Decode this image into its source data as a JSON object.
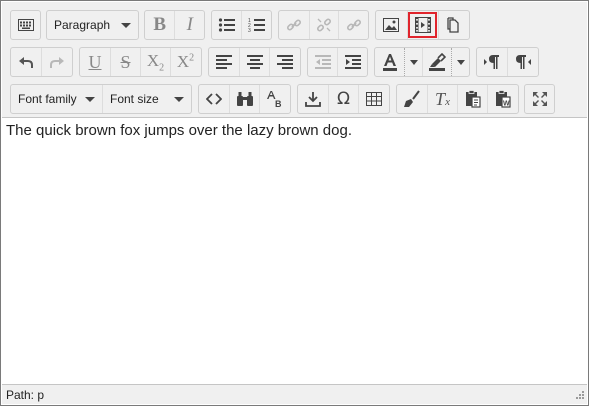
{
  "editor": {
    "content_text": "The quick brown fox jumps over the lazy brown dog.",
    "status_path": "Path: p"
  },
  "toolbar": {
    "row1": {
      "format_select": "Paragraph",
      "bold_label": "B",
      "italic_label": "I"
    },
    "row3": {
      "font_family_select": "Font family",
      "font_size_select": "Font size"
    }
  },
  "colors": {
    "toolbar_bg": "#f0f0f0",
    "highlight_outline": "#e0242c",
    "disabled_icon": "#b8b8b8"
  }
}
